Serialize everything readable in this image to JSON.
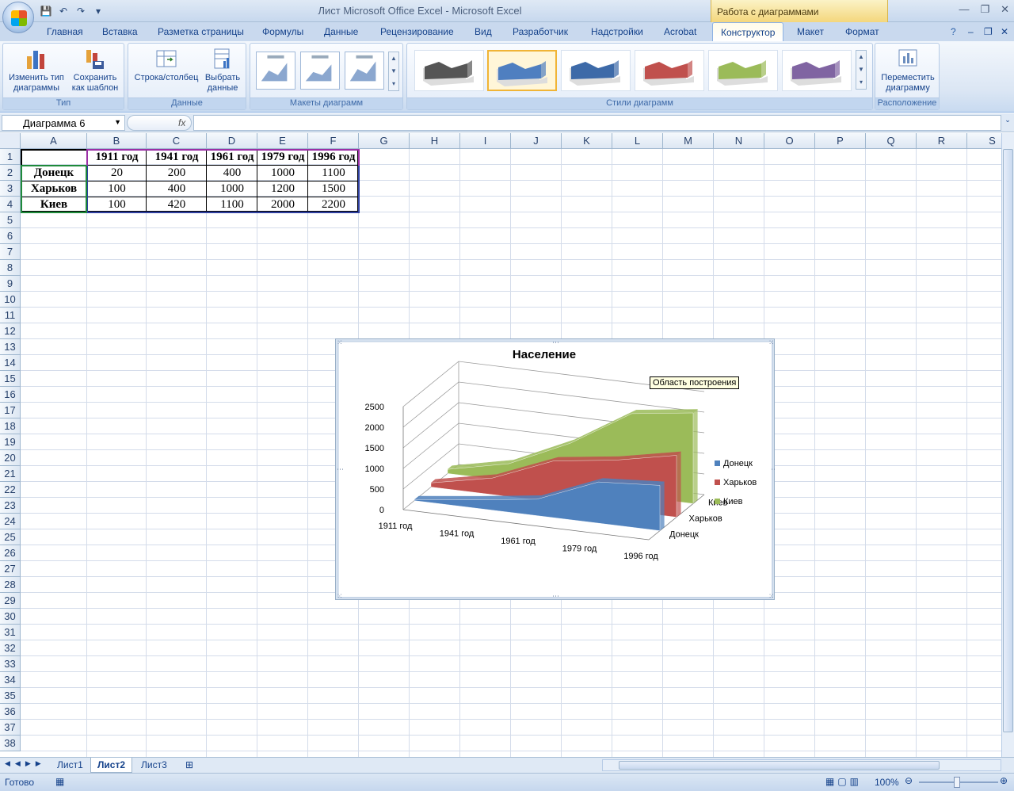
{
  "window": {
    "title": "Лист Microsoft Office Excel - Microsoft Excel",
    "context_group": "Работа с диаграммами"
  },
  "tabs": [
    "Главная",
    "Вставка",
    "Разметка страницы",
    "Формулы",
    "Данные",
    "Рецензирование",
    "Вид",
    "Разработчик",
    "Надстройки",
    "Acrobat",
    "Конструктор",
    "Макет",
    "Формат"
  ],
  "active_tab": "Конструктор",
  "ribbon": {
    "type_group": {
      "label": "Тип",
      "change_type": "Изменить тип диаграммы",
      "save_template": "Сохранить как шаблон"
    },
    "data_group": {
      "label": "Данные",
      "row_col": "Строка/столбец",
      "select_data": "Выбрать данные"
    },
    "layouts_label": "Макеты диаграмм",
    "styles_label": "Стили диаграмм",
    "location_group": {
      "label": "Расположение",
      "move_chart": "Переместить диаграмму"
    },
    "style_colors": [
      "#555555",
      "#4f7fc0",
      "#3d6aa8",
      "#c0504d",
      "#9bbb59",
      "#8064a2"
    ],
    "selected_style_index": 1
  },
  "formula_bar": {
    "name_box": "Диаграмма 6",
    "fx": "fx",
    "formula": ""
  },
  "columns": [
    "A",
    "B",
    "C",
    "D",
    "E",
    "F",
    "G",
    "H",
    "I",
    "J",
    "K",
    "L",
    "M",
    "N",
    "O",
    "P",
    "Q",
    "R",
    "S"
  ],
  "rows": [
    "1",
    "2",
    "3",
    "4",
    "5",
    "6",
    "7",
    "8",
    "9",
    "10",
    "11",
    "12",
    "13",
    "14",
    "15",
    "16",
    "17",
    "18",
    "19",
    "20",
    "21",
    "22",
    "23",
    "24",
    "25",
    "26",
    "27",
    "28",
    "29",
    "30",
    "31",
    "32",
    "33",
    "34",
    "35",
    "36",
    "37",
    "38"
  ],
  "table": {
    "headers": [
      "1911 год",
      "1941 год",
      "1961 год",
      "1979 год",
      "1996 год"
    ],
    "rows": [
      {
        "name": "Донецк",
        "values": [
          "20",
          "200",
          "400",
          "1000",
          "1100"
        ]
      },
      {
        "name": "Харьков",
        "values": [
          "100",
          "400",
          "1000",
          "1200",
          "1500"
        ]
      },
      {
        "name": "Киев",
        "values": [
          "100",
          "420",
          "1100",
          "2000",
          "2200"
        ]
      }
    ]
  },
  "chart_data": {
    "type": "area",
    "title": "Население",
    "categories": [
      "1911 год",
      "1941 год",
      "1961 год",
      "1979 год",
      "1996 год"
    ],
    "series": [
      {
        "name": "Донецк",
        "values": [
          20,
          200,
          400,
          1000,
          1100
        ],
        "color": "#4f81bd"
      },
      {
        "name": "Харьков",
        "values": [
          100,
          400,
          1000,
          1200,
          1500
        ],
        "color": "#c0504d"
      },
      {
        "name": "Киев",
        "values": [
          100,
          420,
          1100,
          2000,
          2200
        ],
        "color": "#9bbb59"
      }
    ],
    "ylim": [
      0,
      2500
    ],
    "yticks": [
      "0",
      "500",
      "1000",
      "1500",
      "2000",
      "2500"
    ],
    "depth_labels": [
      "Киев",
      "Харьков",
      "Донецк"
    ],
    "legend": "right",
    "grid": true,
    "tooltip": "Область построения"
  },
  "sheets": [
    "Лист1",
    "Лист2",
    "Лист3"
  ],
  "active_sheet": "Лист2",
  "status": {
    "ready": "Готово",
    "zoom": "100%"
  }
}
